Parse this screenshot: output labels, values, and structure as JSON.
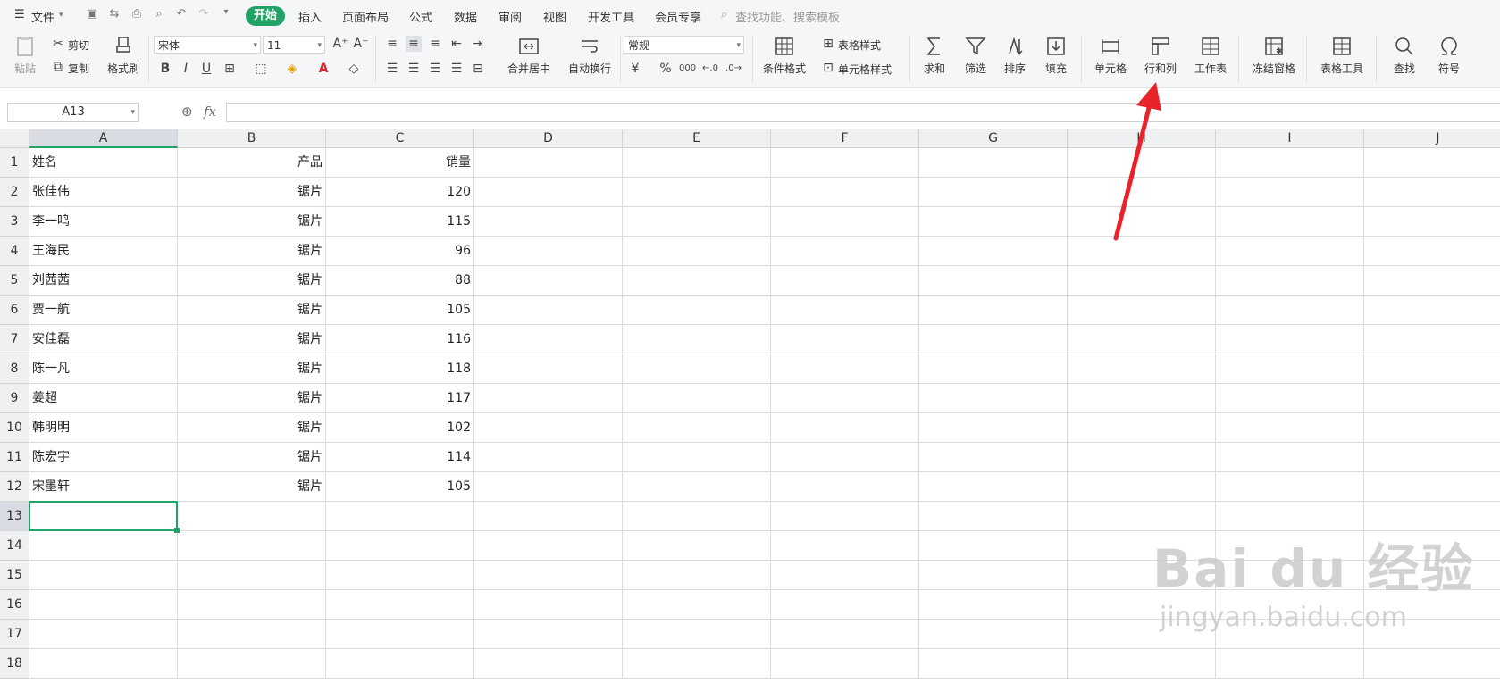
{
  "menu": {
    "file_label": "文件",
    "tabs": [
      "开始",
      "插入",
      "页面布局",
      "公式",
      "数据",
      "审阅",
      "视图",
      "开发工具",
      "会员专享"
    ],
    "search_placeholder": "查找功能、搜索模板"
  },
  "ribbon": {
    "paste": "粘贴",
    "cut": "剪切",
    "copy": "复制",
    "format_painter": "格式刷",
    "font_name": "宋体",
    "font_size": "11",
    "merge_center": "合并居中",
    "wrap_text": "自动换行",
    "number_format": "常规",
    "conditional_format": "条件格式",
    "table_style": "表格样式",
    "cell_style": "单元格样式",
    "sum": "求和",
    "filter": "筛选",
    "sort": "排序",
    "fill": "填充",
    "cell": "单元格",
    "rows_cols": "行和列",
    "worksheet": "工作表",
    "freeze": "冻结窗格",
    "table_tools": "表格工具",
    "find": "查找",
    "symbol": "符号",
    "bold": "B",
    "italic": "I",
    "underline": "U",
    "currency": "¥",
    "percent": "%",
    "thousands": "000"
  },
  "formula_bar": {
    "name_box": "A13",
    "fx": "fx",
    "value": ""
  },
  "sheet": {
    "columns": [
      "A",
      "B",
      "C",
      "D",
      "E",
      "F",
      "G",
      "H",
      "I",
      "J"
    ],
    "rows": [
      "1",
      "2",
      "3",
      "4",
      "5",
      "6",
      "7",
      "8",
      "9",
      "10",
      "11",
      "12",
      "13",
      "14",
      "15",
      "16",
      "17",
      "18"
    ],
    "data": [
      [
        "姓名",
        "产品",
        "销量"
      ],
      [
        "张佳伟",
        "锯片",
        "120"
      ],
      [
        "李一鸣",
        "锯片",
        "115"
      ],
      [
        "王海民",
        "锯片",
        "96"
      ],
      [
        "刘茜茜",
        "锯片",
        "88"
      ],
      [
        "贾一航",
        "锯片",
        "105"
      ],
      [
        "安佳磊",
        "锯片",
        "116"
      ],
      [
        "陈一凡",
        "锯片",
        "118"
      ],
      [
        "姜超",
        "锯片",
        "117"
      ],
      [
        "韩明明",
        "锯片",
        "102"
      ],
      [
        "陈宏宇",
        "锯片",
        "114"
      ],
      [
        "宋墨轩",
        "锯片",
        "105"
      ]
    ],
    "active_cell": "A13"
  },
  "watermark": {
    "brand": "Bai du 经验",
    "url": "jingyan.baidu.com"
  },
  "colors": {
    "accent": "#21a366",
    "arrow": "#e8232a"
  }
}
